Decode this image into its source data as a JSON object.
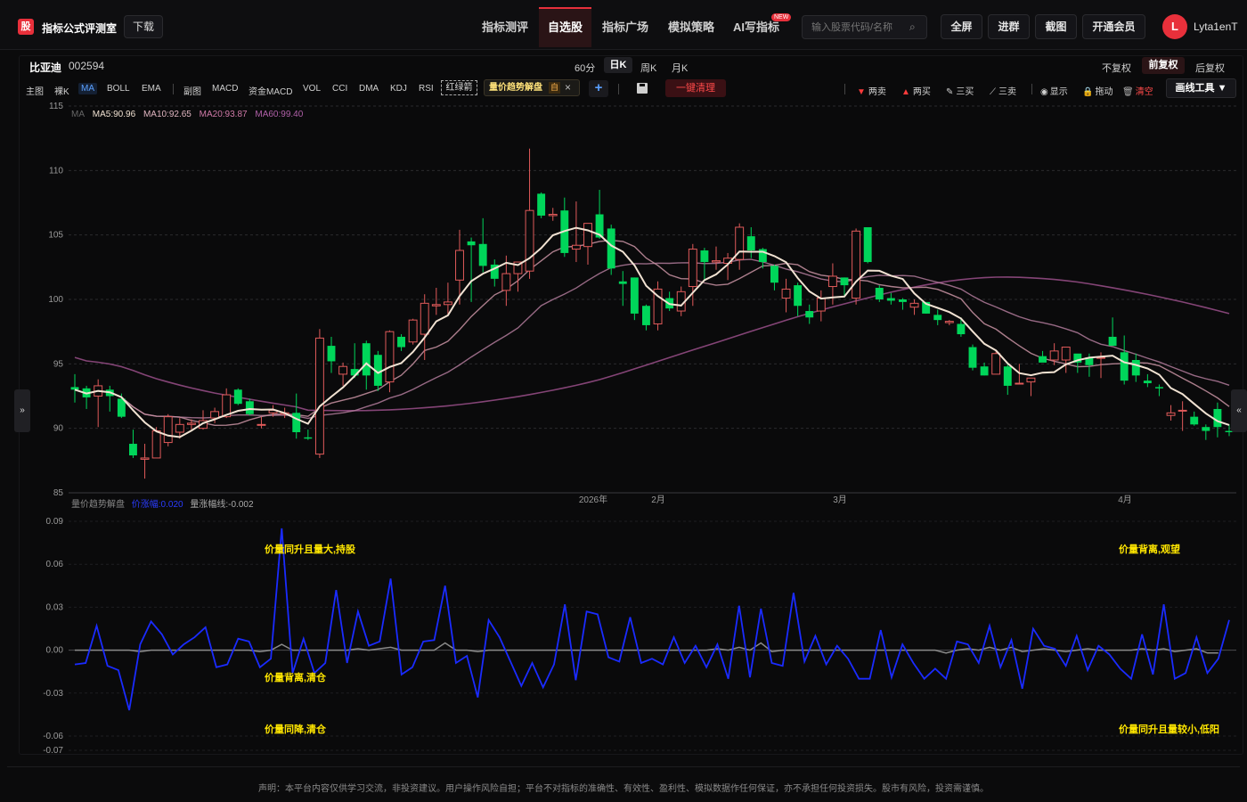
{
  "header": {
    "logo_char": "股",
    "brand": "指标公式评测室",
    "download": "下载",
    "nav": [
      "指标测评",
      "自选股",
      "指标广场",
      "模拟策略",
      "AI写指标"
    ],
    "new_badge": "NEW",
    "search_placeholder": "输入股票代码/名称",
    "buttons": [
      "全屏",
      "进群",
      "截图",
      "开通会员"
    ],
    "avatar_letter": "L",
    "username": "Lyta1enT"
  },
  "stock": {
    "name": "比亚迪",
    "code": "002594"
  },
  "periods": [
    "60分",
    "日K",
    "周K",
    "月K"
  ],
  "adjust": [
    "不复权",
    "前复权",
    "后复权"
  ],
  "indicators": [
    "主图",
    "裸K",
    "MA",
    "BOLL",
    "EMA",
    "副图",
    "MACD",
    "资金MACD",
    "VOL",
    "CCI",
    "DMA",
    "KDJ",
    "RSI"
  ],
  "red_green_arrow": "红绿箭",
  "custom_indicator": {
    "name": "量价趋势解盘",
    "tag": "自",
    "close": "×"
  },
  "add": "+",
  "clear_all": "一键清理",
  "draw_items": [
    "两卖",
    "两买",
    "三买",
    "三卖",
    "显示",
    "拖动",
    "清空"
  ],
  "draw_tools": "画线工具 ▼",
  "side_left": "»",
  "side_right": "«",
  "ma_legend": {
    "label": "MA",
    "ma5": "MA5:90.96",
    "ma10": "MA10:92.65",
    "ma20": "MA20:93.87",
    "ma60": "MA60:99.40"
  },
  "lower_legend": {
    "name": "量价趋势解盘",
    "price": "价涨幅:0.020",
    "vol": "量涨幅线:-0.002"
  },
  "colors": {
    "up": "#e05a5a",
    "down": "#00d65a",
    "ma5": "#f1e2d2",
    "ma10": "#c993a3",
    "ma20": "#b07a9a",
    "ma60": "#9a4f8a",
    "osc": "#1a2bff",
    "accent": "#e8303b"
  },
  "chart_data": [
    {
      "type": "candlestick",
      "ylim": [
        85,
        115
      ],
      "yticks": [
        85,
        90,
        95,
        100,
        105,
        110,
        115
      ],
      "x_labels": [
        "2026年",
        "2月",
        "3月",
        "4月"
      ],
      "candles": [
        [
          93.2,
          94.2,
          92.0,
          93.0
        ],
        [
          93.1,
          93.3,
          91.5,
          92.4
        ],
        [
          92.5,
          93.8,
          90.1,
          93.3
        ],
        [
          93.0,
          93.3,
          91.3,
          92.5
        ],
        [
          92.3,
          92.7,
          90.8,
          90.9
        ],
        [
          88.8,
          89.9,
          87.7,
          87.9
        ],
        [
          87.6,
          88.8,
          86.1,
          87.7
        ],
        [
          87.7,
          90.1,
          87.7,
          89.8
        ],
        [
          88.9,
          91.1,
          88.6,
          90.9
        ],
        [
          89.7,
          90.8,
          89.2,
          90.3
        ],
        [
          90.3,
          90.7,
          89.9,
          90.4
        ],
        [
          90.0,
          91.4,
          89.9,
          90.6
        ],
        [
          90.8,
          91.6,
          90.4,
          91.3
        ],
        [
          90.9,
          93.1,
          90.8,
          92.6
        ],
        [
          93.0,
          93.1,
          91.8,
          91.9
        ],
        [
          92.1,
          92.3,
          91.0,
          91.1
        ],
        [
          90.3,
          90.9,
          90.0,
          90.3
        ],
        [
          91.2,
          91.8,
          90.9,
          91.4
        ],
        [
          91.1,
          91.6,
          90.8,
          91.2
        ],
        [
          91.2,
          92.7,
          89.2,
          89.7
        ],
        [
          89.3,
          89.9,
          89.1,
          89.2
        ],
        [
          88.0,
          97.7,
          87.7,
          97.0
        ],
        [
          96.4,
          97.1,
          94.3,
          95.2
        ],
        [
          94.2,
          95.1,
          93.3,
          94.8
        ],
        [
          94.6,
          96.6,
          93.9,
          94.1
        ],
        [
          96.6,
          96.8,
          93.0,
          94.1
        ],
        [
          95.7,
          96.0,
          92.9,
          93.3
        ],
        [
          93.6,
          97.6,
          92.8,
          97.5
        ],
        [
          97.1,
          97.3,
          96.0,
          96.3
        ],
        [
          96.7,
          98.5,
          96.5,
          98.4
        ],
        [
          97.3,
          100.4,
          95.3,
          99.7
        ],
        [
          99.5,
          100.9,
          98.8,
          99.6
        ],
        [
          99.6,
          101.3,
          98.8,
          99.8
        ],
        [
          101.5,
          105.4,
          99.6,
          103.8
        ],
        [
          104.5,
          104.8,
          99.8,
          104.2
        ],
        [
          104.3,
          106.3,
          102.1,
          102.6
        ],
        [
          102.7,
          103.1,
          101.0,
          101.6
        ],
        [
          100.7,
          103.4,
          99.5,
          102.0
        ],
        [
          102.0,
          102.8,
          100.6,
          102.9
        ],
        [
          102.2,
          111.7,
          101.6,
          106.9
        ],
        [
          108.2,
          108.3,
          106.3,
          106.5
        ],
        [
          106.5,
          107.1,
          106.1,
          106.6
        ],
        [
          106.9,
          107.9,
          103.3,
          103.6
        ],
        [
          103.9,
          107.6,
          102.9,
          104.2
        ],
        [
          104.1,
          105.9,
          102.7,
          105.9
        ],
        [
          106.6,
          108.5,
          104.7,
          104.8
        ],
        [
          105.5,
          105.8,
          101.9,
          102.4
        ],
        [
          101.4,
          102.2,
          99.5,
          101.2
        ],
        [
          101.7,
          101.7,
          98.4,
          98.9
        ],
        [
          99.5,
          99.6,
          97.6,
          98.0
        ],
        [
          98.1,
          101.4,
          97.6,
          100.8
        ],
        [
          100.1,
          100.6,
          99.1,
          99.3
        ],
        [
          99.1,
          101.0,
          98.7,
          100.6
        ],
        [
          101.0,
          104.3,
          99.5,
          103.9
        ],
        [
          103.8,
          104.0,
          101.5,
          102.9
        ],
        [
          102.9,
          104.1,
          102.3,
          103.0
        ],
        [
          102.8,
          103.6,
          101.5,
          103.2
        ],
        [
          103.1,
          105.9,
          102.3,
          105.6
        ],
        [
          104.9,
          105.6,
          103.2,
          103.8
        ],
        [
          103.9,
          104.0,
          102.4,
          102.9
        ],
        [
          102.6,
          102.7,
          100.7,
          101.3
        ],
        [
          100.1,
          101.6,
          99.0,
          100.8
        ],
        [
          101.1,
          101.3,
          98.7,
          99.5
        ],
        [
          99.1,
          99.6,
          98.1,
          98.6
        ],
        [
          99.1,
          100.7,
          98.3,
          100.1
        ],
        [
          101.0,
          102.8,
          99.6,
          101.8
        ],
        [
          101.7,
          101.7,
          100.3,
          101.1
        ],
        [
          100.1,
          105.5,
          99.6,
          105.3
        ],
        [
          105.6,
          105.5,
          102.8,
          102.9
        ],
        [
          100.9,
          101.1,
          99.8,
          100.0
        ],
        [
          100.1,
          100.5,
          99.6,
          99.9
        ],
        [
          100.0,
          100.1,
          99.2,
          99.8
        ],
        [
          99.4,
          100.0,
          98.8,
          99.7
        ],
        [
          99.8,
          99.8,
          98.9,
          98.9
        ],
        [
          98.8,
          99.2,
          98.0,
          98.4
        ],
        [
          98.2,
          98.4,
          98.0,
          98.3
        ],
        [
          98.1,
          98.6,
          97.1,
          97.3
        ],
        [
          96.3,
          96.5,
          94.5,
          94.7
        ],
        [
          94.8,
          95.1,
          94.1,
          94.1
        ],
        [
          94.2,
          96.0,
          94.3,
          95.8
        ],
        [
          94.8,
          95.0,
          92.6,
          93.3
        ],
        [
          93.5,
          95.0,
          93.4,
          93.5
        ],
        [
          93.6,
          93.6,
          92.5,
          93.9
        ],
        [
          95.6,
          96.0,
          95.2,
          95.1
        ],
        [
          95.3,
          96.6,
          94.9,
          96.0
        ],
        [
          95.3,
          96.0,
          94.3,
          96.3
        ],
        [
          95.8,
          95.5,
          94.3,
          95.1
        ],
        [
          95.5,
          95.8,
          94.0,
          94.9
        ],
        [
          95.5,
          95.9,
          93.9,
          95.5
        ],
        [
          97.1,
          98.6,
          96.8,
          96.4
        ],
        [
          95.9,
          97.2,
          93.4,
          93.7
        ],
        [
          95.3,
          95.8,
          93.6,
          94.1
        ],
        [
          93.7,
          94.2,
          93.2,
          93.5
        ],
        [
          93.2,
          93.4,
          92.5,
          93.1
        ],
        [
          91.0,
          91.8,
          90.6,
          91.2
        ],
        [
          91.4,
          92.1,
          89.8,
          91.4
        ],
        [
          90.9,
          91.3,
          90.2,
          90.3
        ],
        [
          90.1,
          90.3,
          89.1,
          89.8
        ],
        [
          91.5,
          92.0,
          89.3,
          90.1
        ],
        [
          89.8,
          90.3,
          89.4,
          89.7
        ]
      ],
      "ma_legend": [
        "MA5:90.96",
        "MA10:92.65",
        "MA20:93.87",
        "MA60:99.40"
      ]
    },
    {
      "type": "line",
      "title": "量价趋势解盘",
      "ylim": [
        -0.07,
        0.09
      ],
      "yticks": [
        0.09,
        0.06,
        0.03,
        0.0,
        -0.03,
        -0.06,
        -0.07
      ],
      "annotations": [
        "价量同升且量大,持股",
        "价量背离,观望",
        "价量背离,清仓",
        "价量同降,清仓",
        "价量同升且量较小,低阳"
      ],
      "series": [
        {
          "name": "价涨幅",
          "values": [
            -0.01,
            -0.009,
            0.017,
            -0.011,
            -0.014,
            -0.042,
            0.004,
            0.02,
            0.011,
            -0.003,
            0.004,
            0.009,
            0.016,
            -0.012,
            -0.01,
            0.008,
            0.006,
            -0.012,
            -0.006,
            0.085,
            -0.016,
            0.008,
            -0.016,
            -0.009,
            0.042,
            -0.009,
            0.027,
            0.003,
            0.006,
            0.05,
            -0.017,
            -0.012,
            0.006,
            0.007,
            0.045,
            -0.009,
            -0.004,
            -0.033,
            0.021,
            0.009,
            -0.008,
            -0.025,
            -0.009,
            -0.026,
            -0.01,
            0.032,
            -0.021,
            0.027,
            0.025,
            -0.005,
            -0.008,
            0.023,
            -0.009,
            -0.006,
            -0.01,
            0.009,
            -0.009,
            0.003,
            -0.012,
            0.004,
            -0.02,
            0.031,
            -0.019,
            0.029,
            -0.009,
            -0.011,
            0.04,
            -0.008,
            0.01,
            -0.01,
            0.003,
            -0.006,
            -0.02,
            -0.02,
            0.014,
            -0.019,
            0.004,
            -0.009,
            -0.02,
            -0.013,
            -0.02,
            0.006,
            0.004,
            -0.009,
            0.017,
            -0.012,
            0.007,
            -0.027,
            0.015,
            0.003,
            0.001,
            -0.011,
            0.01,
            -0.014,
            0.003,
            -0.003,
            -0.013,
            -0.02,
            0.011,
            -0.017,
            0.032,
            -0.02,
            -0.016,
            0.009,
            -0.016,
            -0.006,
            0.021
          ]
        },
        {
          "name": "量涨幅线",
          "values": [
            0.0,
            0.0,
            0.0,
            0.0,
            0.0,
            0.0,
            -0.001,
            0.0,
            0.0,
            0.0,
            0.0,
            0.0,
            0.0,
            0.0,
            0.0,
            0.0,
            0.0,
            -0.001,
            0.0,
            0.004,
            0.0,
            0.0,
            0.0,
            0.0,
            0.0,
            0.0,
            0.001,
            0.0,
            0.001,
            0.002,
            0.0,
            0.0,
            0.0,
            0.0,
            0.005,
            0.0,
            0.0,
            -0.001,
            0.0,
            0.0,
            0.0,
            0.0,
            0.0,
            0.0,
            0.0,
            0.0,
            0.0,
            0.0,
            0.0,
            0.0,
            0.0,
            0.0,
            0.0,
            0.0,
            0.0,
            0.0,
            0.0,
            0.0,
            0.0,
            0.001,
            0.0,
            0.002,
            0.0,
            0.005,
            -0.001,
            0.0,
            0.0,
            0.0,
            0.0,
            0.0,
            0.0,
            0.0,
            0.0,
            0.0,
            0.0,
            0.0,
            0.0,
            0.0,
            0.0,
            0.0,
            -0.002,
            0.0,
            0.001,
            0.0,
            0.002,
            0.0,
            0.002,
            -0.001,
            0.0,
            0.001,
            0.0,
            -0.001,
            0.0,
            0.001,
            0.0,
            0.0,
            0.0,
            0.0,
            0.001,
            0.0,
            0.001,
            -0.001,
            0.0,
            0.001,
            -0.002,
            -0.002
          ]
        }
      ]
    }
  ],
  "disclaimer": "声明：本平台内容仅供学习交流，非投资建议。用户操作风险自担；平台不对指标的准确性、有效性、盈利性、模拟数据作任何保证，亦不承担任何投资损失。股市有风险，投资需谨慎。"
}
